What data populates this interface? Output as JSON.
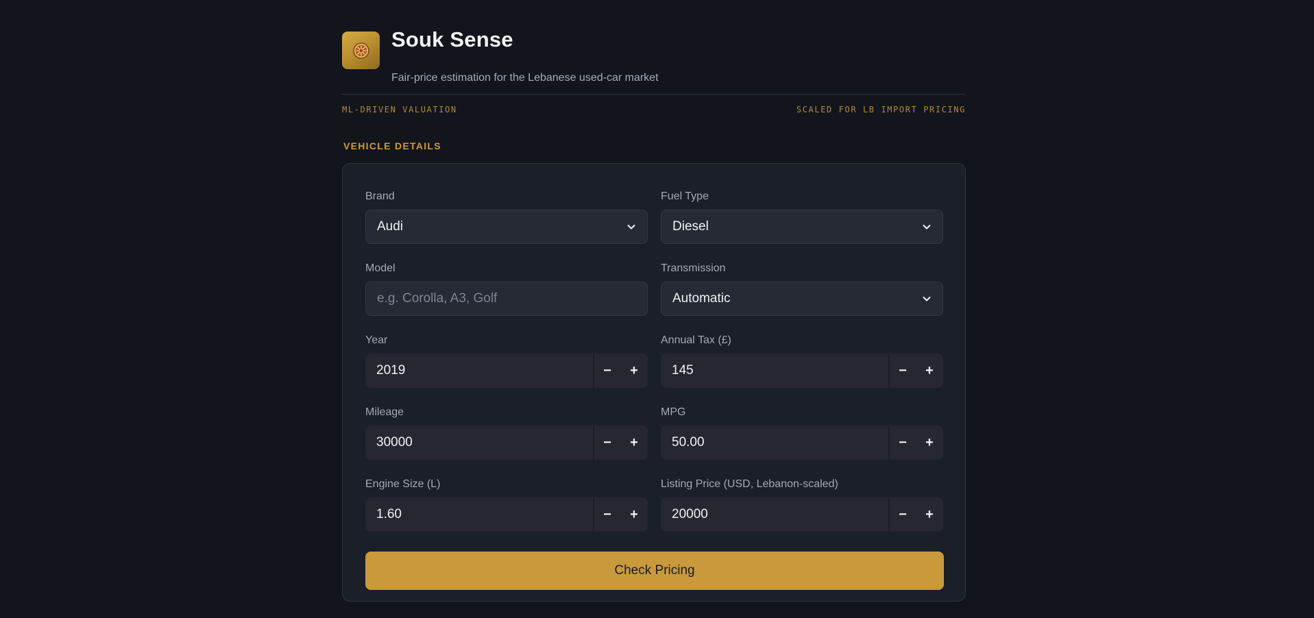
{
  "app": {
    "title": "Souk Sense",
    "subtitle": "Fair-price estimation for the Lebanese used-car market",
    "tag_left": "ML-DRIVEN VALUATION",
    "tag_right": "SCALED FOR LB IMPORT PRICING"
  },
  "section": {
    "label": "VEHICLE DETAILS"
  },
  "form": {
    "brand": {
      "label": "Brand",
      "value": "Audi"
    },
    "fuel_type": {
      "label": "Fuel Type",
      "value": "Diesel"
    },
    "model": {
      "label": "Model",
      "placeholder": "e.g. Corolla, A3, Golf",
      "value": ""
    },
    "transmission": {
      "label": "Transmission",
      "value": "Automatic"
    },
    "year": {
      "label": "Year",
      "value": "2019"
    },
    "annual_tax": {
      "label": "Annual Tax (£)",
      "value": "145"
    },
    "mileage": {
      "label": "Mileage",
      "value": "30000"
    },
    "mpg": {
      "label": "MPG",
      "value": "50.00"
    },
    "engine_size": {
      "label": "Engine Size (L)",
      "value": "1.60"
    },
    "listing_price": {
      "label": "Listing Price (USD, Lebanon-scaled)",
      "value": "20000"
    },
    "stepper": {
      "minus": "−",
      "plus": "+"
    },
    "submit_label": "Check Pricing"
  },
  "icons": {
    "logo": "wheel-icon",
    "dropdown": "chevron-down-icon"
  },
  "colors": {
    "accent": "#c99a3b",
    "background": "#12151c",
    "card": "#1b1f28"
  }
}
